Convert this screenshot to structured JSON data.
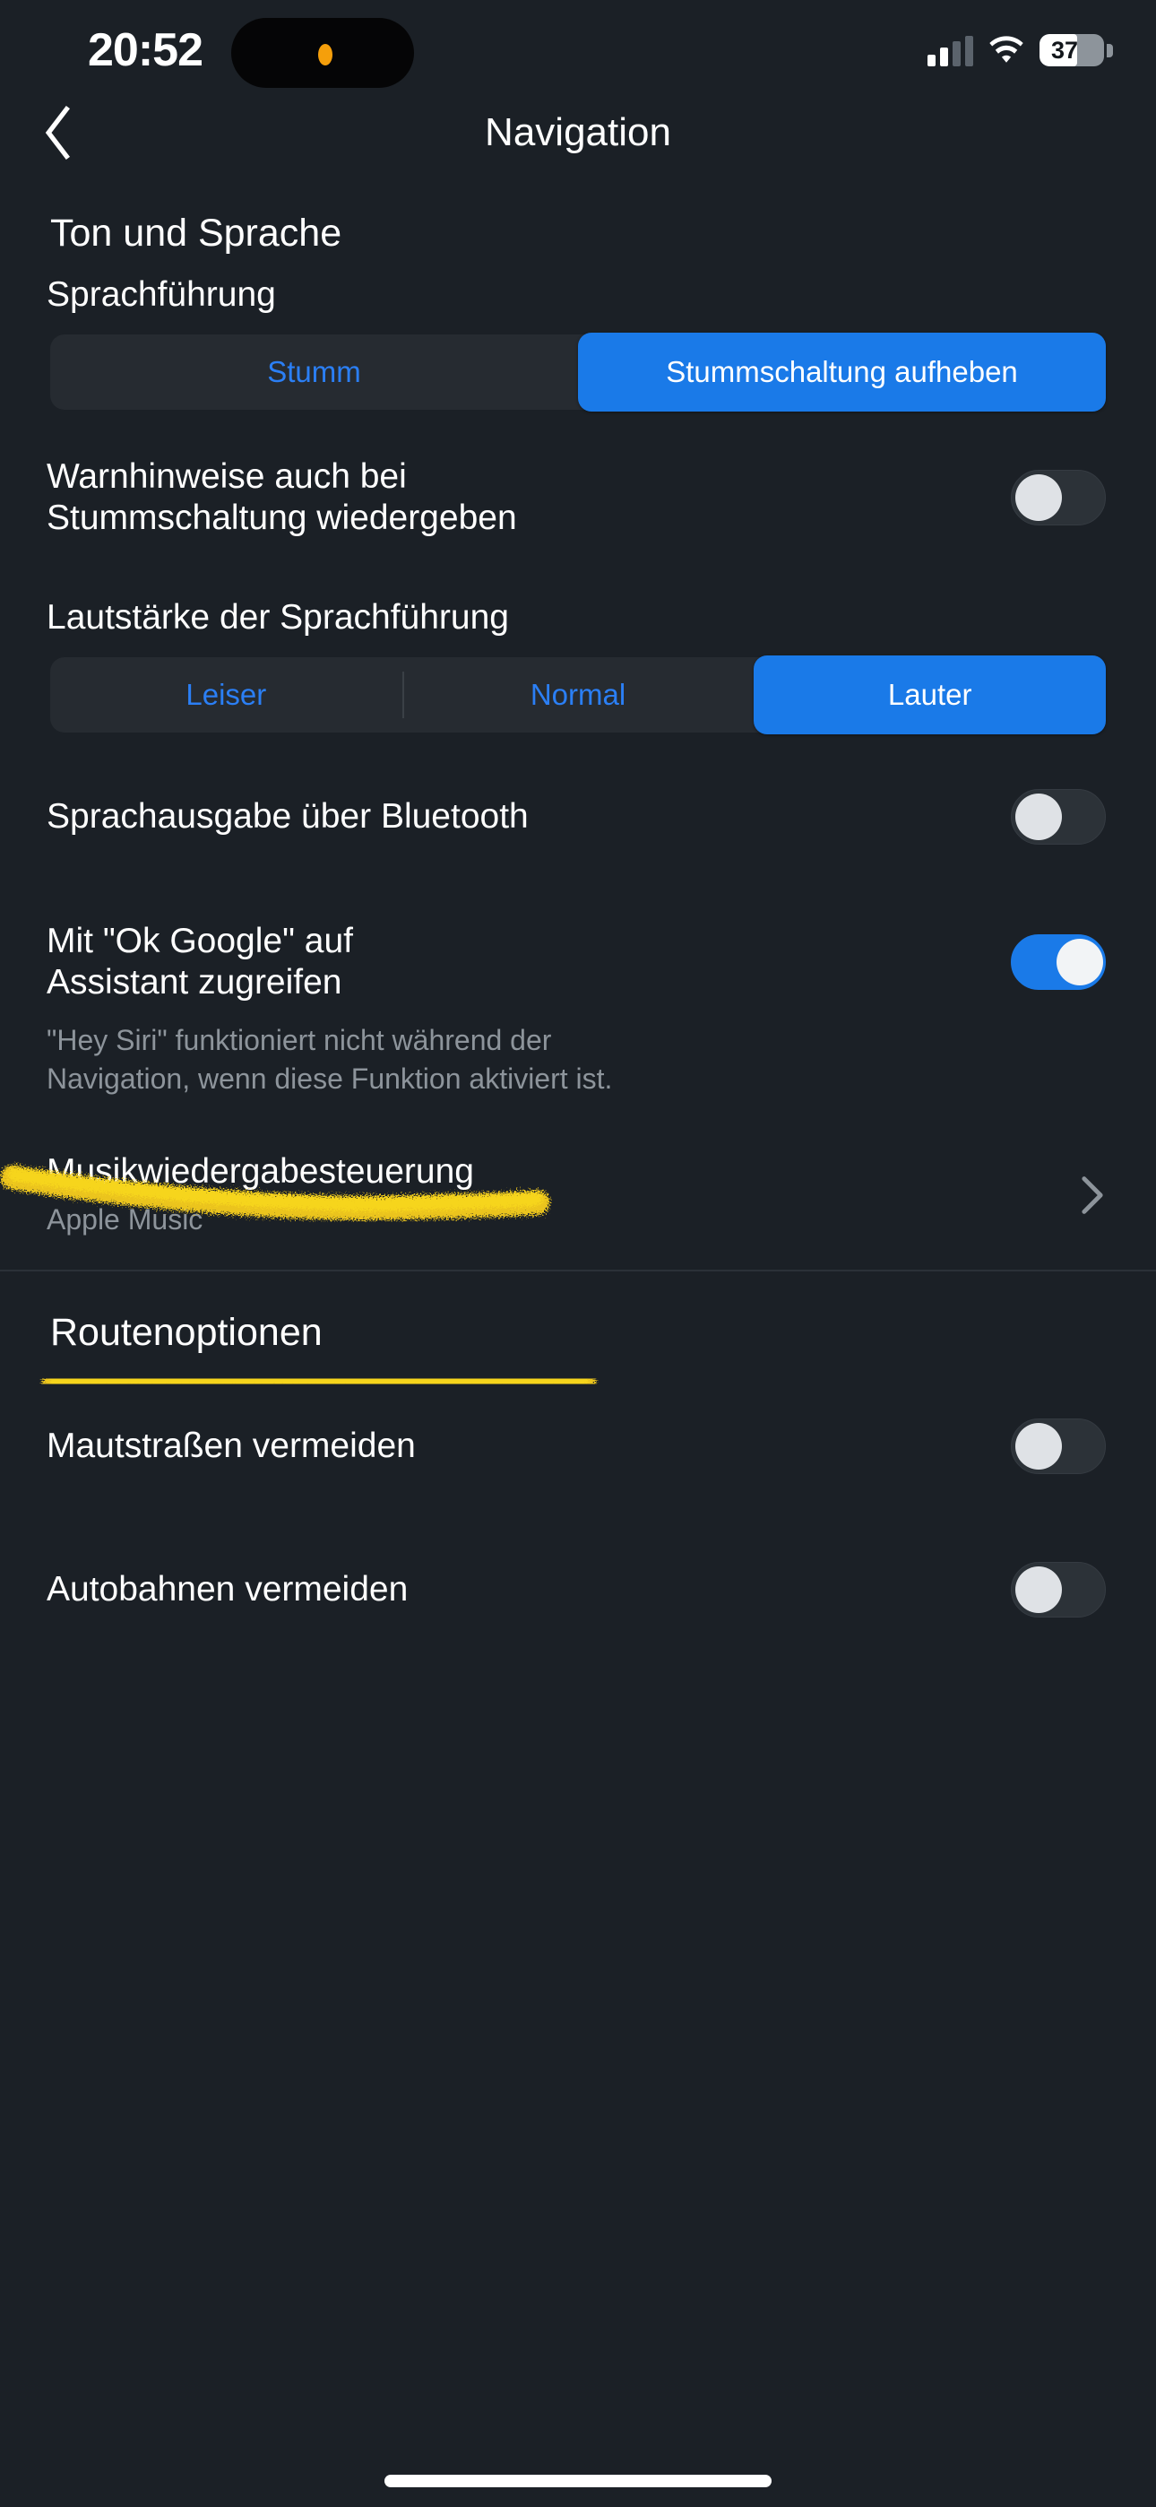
{
  "status_bar": {
    "time": "20:52",
    "location_icon": "location-arrow-icon",
    "signal_icon": "cellular-signal-icon",
    "wifi_icon": "wifi-icon",
    "battery_percent": "37",
    "battery_icon": "battery-icon"
  },
  "navbar": {
    "back_icon": "chevron-left-icon",
    "title": "Navigation"
  },
  "sections": {
    "sound": {
      "heading": "Ton und Sprache",
      "voice_guidance": {
        "label": "Sprachführung",
        "options": [
          "Stumm",
          "Stummschaltung aufheben"
        ],
        "selected": "Stummschaltung aufheben"
      },
      "alerts_when_muted": {
        "label_line1": "Warnhinweise auch bei",
        "label_line2": "Stummschaltung wiedergeben",
        "state": "off"
      },
      "volume": {
        "label": "Lautstärke der Sprachführung",
        "options": [
          "Leiser",
          "Normal",
          "Lauter"
        ],
        "selected": "Lauter"
      },
      "bluetooth_audio": {
        "label": "Sprachausgabe über Bluetooth",
        "state": "off"
      },
      "ok_google": {
        "label_line1": "Mit \"Ok Google\" auf",
        "label_line2": "Assistant zugreifen",
        "state": "on",
        "caption_line1": "\"Hey Siri\" funktioniert nicht während der",
        "caption_line2": "Navigation, wenn diese Funktion aktiviert ist."
      },
      "music_playback": {
        "title": "Musikwiedergabesteuerung",
        "value": "Apple Music",
        "chevron_icon": "chevron-right-icon"
      }
    },
    "route": {
      "heading": "Routenoptionen",
      "avoid_tolls": {
        "label": "Mautstraßen vermeiden",
        "state": "off"
      },
      "avoid_highways": {
        "label": "Autobahnen vermeiden",
        "state": "off"
      }
    }
  },
  "annotations": {
    "highlighter_color": "#f2c91a",
    "strokes": [
      {
        "name": "highlight-stroke-volume"
      },
      {
        "name": "highlight-stroke-bluetooth"
      }
    ]
  },
  "colors": {
    "background": "#1b2026",
    "accent_blue": "#1a7ae8",
    "segment_track": "#262b31",
    "text_primary": "#ffffff",
    "text_secondary": "#8d949b",
    "highlighter": "#f2c91a"
  }
}
